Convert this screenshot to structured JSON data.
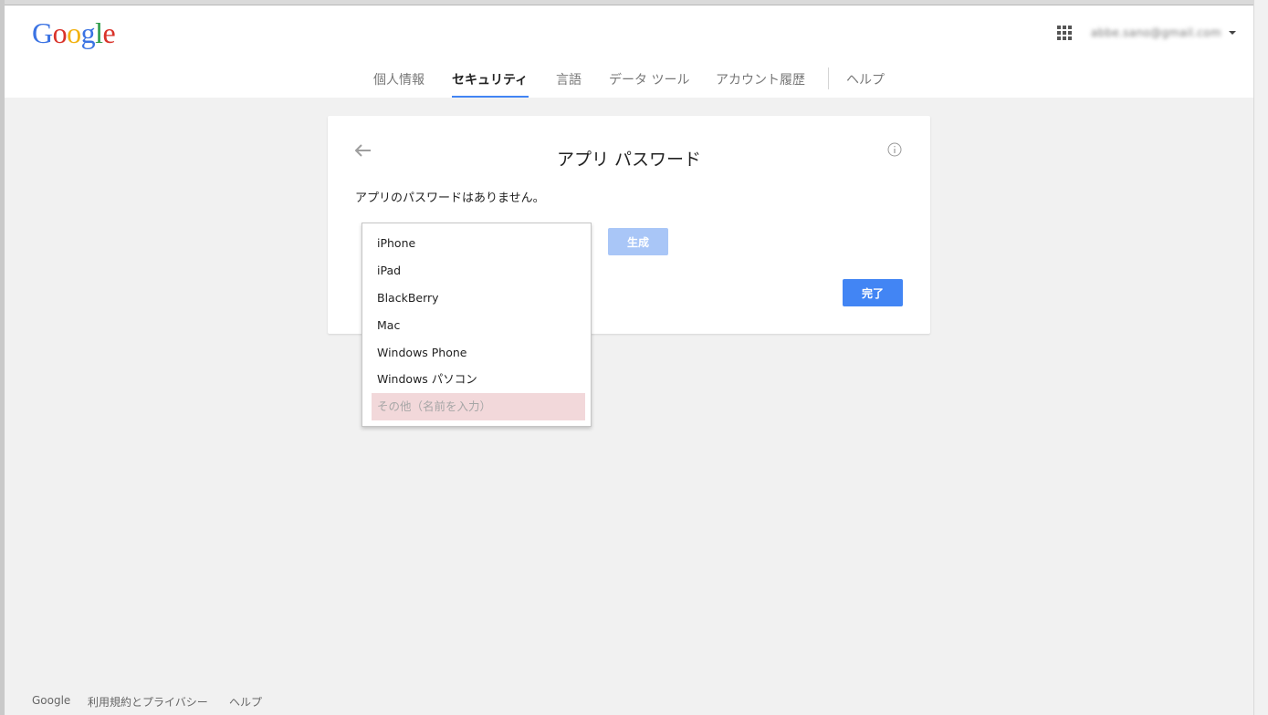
{
  "header": {
    "logo_letters": [
      "G",
      "o",
      "o",
      "g",
      "l",
      "e"
    ],
    "logo_colors": [
      "#3b73e3",
      "#d9332a",
      "#f2b211",
      "#3b73e3",
      "#2e9c4a",
      "#d9332a"
    ],
    "account_email": "abbe.sano@gmail.com",
    "nav_tabs": [
      "個人情報",
      "セキュリティ",
      "言語",
      "データ ツール",
      "アカウント履歴"
    ],
    "nav_help": "ヘルプ",
    "active_tab": "セキュリティ"
  },
  "card": {
    "title": "アプリ パスワード",
    "no_passwords_text": "アプリのパスワードはありません。",
    "generate_label": "生成",
    "done_label": "完了"
  },
  "dropdown": {
    "items": [
      "iPhone",
      "iPad",
      "BlackBerry",
      "Mac",
      "Windows Phone",
      "Windows パソコン",
      "その他（名前を入力）"
    ],
    "highlighted_item": "その他（名前を入力）"
  },
  "footer": {
    "links": [
      "Google",
      "利用規約とプライバシー",
      "ヘルプ"
    ]
  },
  "colors": {
    "accent": "#4285f4",
    "accent_disabled": "#a9c6f7",
    "highlight": "#f2d8da"
  }
}
